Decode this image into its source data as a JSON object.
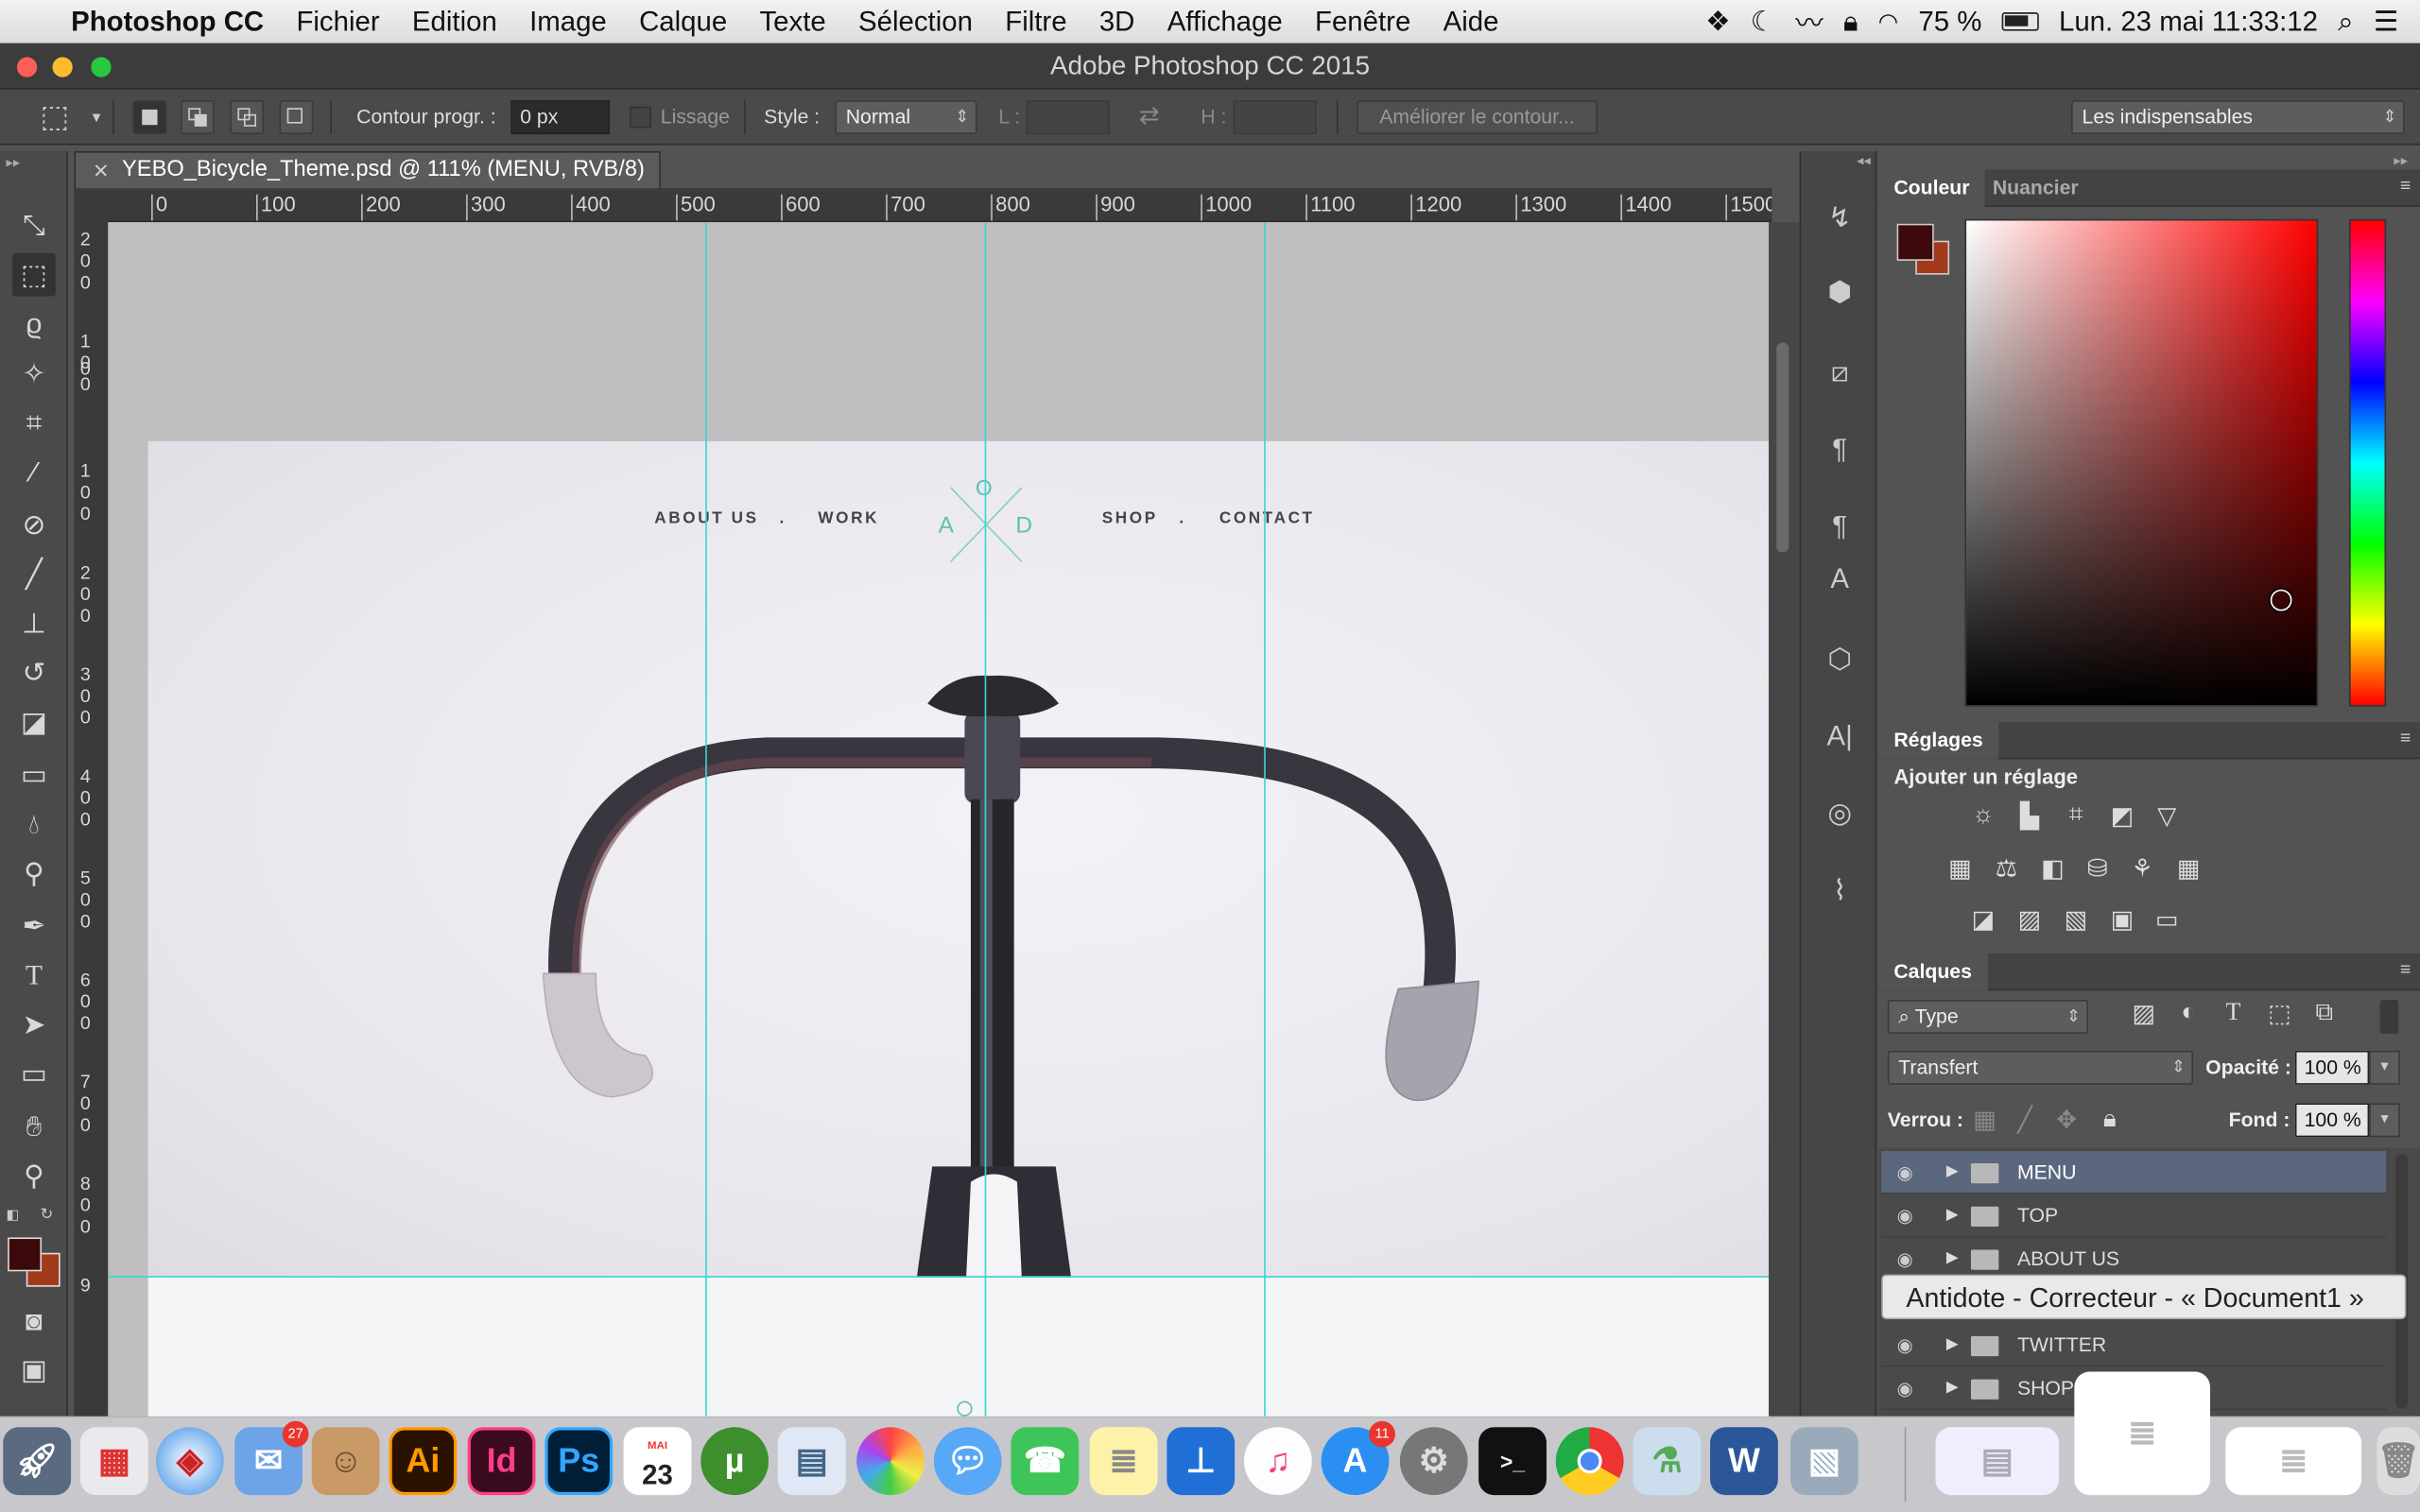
{
  "menubar": {
    "app": "Photoshop CC",
    "items": [
      "Fichier",
      "Edition",
      "Image",
      "Calque",
      "Texte",
      "Sélection",
      "Filtre",
      "3D",
      "Affichage",
      "Fenêtre",
      "Aide"
    ],
    "battery": "75 %",
    "clock": "Lun. 23 mai  11:33:12"
  },
  "window": {
    "title": "Adobe Photoshop CC 2015"
  },
  "options": {
    "contour_label": "Contour progr. :",
    "contour_value": "0 px",
    "lissage_label": "Lissage",
    "style_label": "Style :",
    "style_value": "Normal",
    "l_label": "L :",
    "h_label": "H :",
    "refine_button": "Améliorer le contour...",
    "workspace": "Les indispensables"
  },
  "document": {
    "tab_title": "YEBO_Bicycle_Theme.psd @ 111% (MENU, RVB/8)",
    "ruler_h": [
      "0",
      "100",
      "200",
      "300",
      "400",
      "500",
      "600",
      "700",
      "800",
      "900",
      "1000",
      "1100",
      "1200",
      "1300",
      "1400",
      "1500"
    ],
    "ruler_v": [
      [
        "2",
        "0",
        "0"
      ],
      [
        "1",
        "0",
        "0"
      ],
      [
        "0"
      ],
      [
        "1",
        "0",
        "0"
      ],
      [
        "2",
        "0",
        "0"
      ],
      [
        "3",
        "0",
        "0"
      ],
      [
        "4",
        "0",
        "0"
      ],
      [
        "5",
        "0",
        "0"
      ],
      [
        "6",
        "0",
        "0"
      ],
      [
        "7",
        "0",
        "0"
      ],
      [
        "8",
        "0",
        "0"
      ],
      [
        "9"
      ]
    ]
  },
  "website": {
    "nav_left": [
      "ABOUT US",
      "WORK"
    ],
    "nav_right": [
      "SHOP",
      "CONTACT"
    ],
    "logo": {
      "top": "O",
      "left": "A",
      "right": "D"
    }
  },
  "panels": {
    "color": {
      "tabs": [
        "Couleur",
        "Nuancier"
      ],
      "fg": "#3c0a0a",
      "bg": "#a23a1c"
    },
    "adjustments": {
      "title": "Réglages",
      "add_label": "Ajouter un réglage"
    },
    "layers": {
      "title": "Calques",
      "filter": "Type",
      "blend": "Transfert",
      "opacity_label": "Opacité :",
      "opacity": "100 %",
      "lock_label": "Verrou :",
      "fill_label": "Fond :",
      "fill": "100 %",
      "items": [
        "MENU",
        "TOP",
        "ABOUT US",
        "TWITTER",
        "SHOP"
      ]
    }
  },
  "tooltip": "Antidote - Correcteur - « Document1 »",
  "dock": {
    "mail_badge": "27",
    "calendar_month": "MAI",
    "calendar_day": "23",
    "appstore_badge": "11",
    "ai": "Ai",
    "id": "Id",
    "ps": "Ps"
  }
}
